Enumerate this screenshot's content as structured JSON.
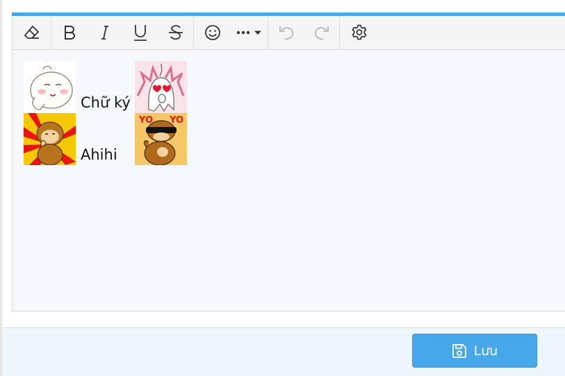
{
  "toolbar": {
    "buttons": [
      {
        "name": "remove-format",
        "icon": "eraser-icon"
      },
      {
        "name": "bold",
        "icon": "bold-icon",
        "glyph": "B"
      },
      {
        "name": "italic",
        "icon": "italic-icon",
        "glyph": "I"
      },
      {
        "name": "underline",
        "icon": "underline-icon",
        "glyph": "U"
      },
      {
        "name": "strikethrough",
        "icon": "strikethrough-icon",
        "glyph": "S"
      },
      {
        "name": "emoji",
        "icon": "smiley-icon"
      },
      {
        "name": "more",
        "icon": "more-dropdown-icon"
      },
      {
        "name": "undo",
        "icon": "undo-icon",
        "disabled": true
      },
      {
        "name": "redo",
        "icon": "redo-icon",
        "disabled": true
      },
      {
        "name": "settings",
        "icon": "gear-icon"
      }
    ]
  },
  "signature": {
    "rows": [
      {
        "text": "Chữ ký",
        "left_emoji": "white-bun-emoji",
        "right_emoji": "love-ghost-emoji"
      },
      {
        "text": "Ahihi",
        "left_emoji": "monkey-sunburst-emoji",
        "right_emoji": "monkey-sunglasses-emoji"
      }
    ]
  },
  "footer": {
    "save_label": "Lưu",
    "save_icon": "save-icon"
  },
  "colors": {
    "accent": "#47a7eb",
    "editor_bg": "#f5f8fc",
    "footer_bg": "#edf5fd"
  }
}
